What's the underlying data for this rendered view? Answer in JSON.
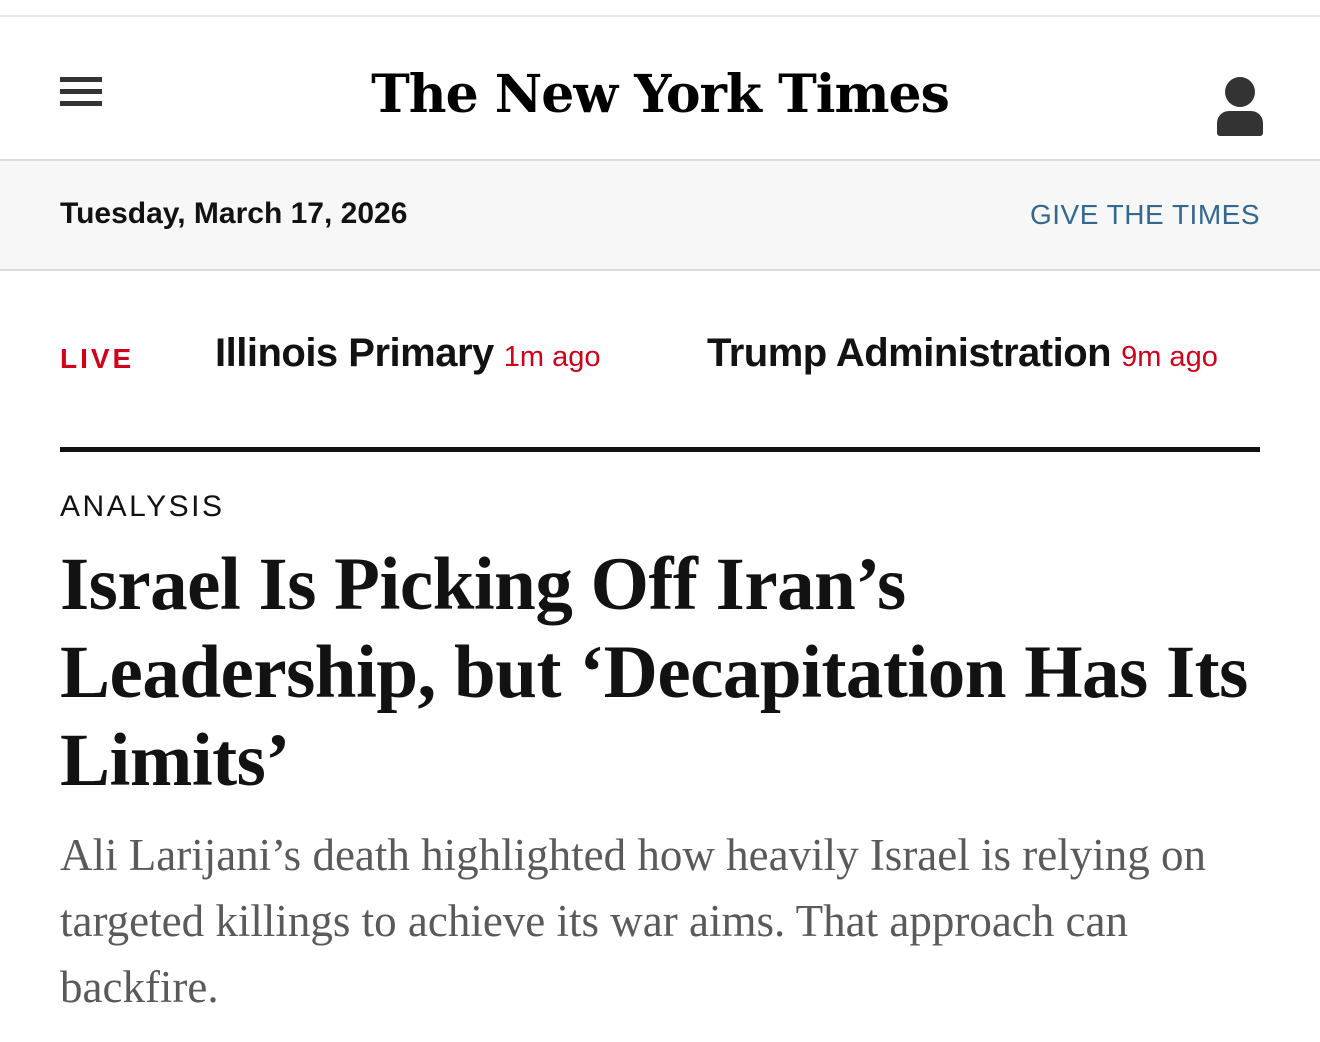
{
  "header": {
    "menu_icon": "hamburger-menu-icon",
    "logo_text": "The New York Times",
    "account_icon": "user-account-icon"
  },
  "date_bar": {
    "date": "Tuesday, March 17, 2026",
    "give_link": "GIVE THE TIMES"
  },
  "live_bar": {
    "label": "LIVE",
    "items": [
      {
        "title": "Illinois Primary",
        "time": "1m ago"
      },
      {
        "title": "Trump Administration",
        "time": "9m ago"
      }
    ]
  },
  "article": {
    "kicker": "ANALYSIS",
    "headline": "Israel Is Picking Off Iran’s Leadership, but ‘Decapitation Has Its Limits’",
    "summary": "Ali Larijani’s death highlighted how heavily Israel is relying on targeted killings to achieve its war aims. That approach can backfire."
  },
  "colors": {
    "live_red": "#d0021b",
    "link_blue": "#326891",
    "text_dark": "#121212",
    "summary_gray": "#5a5a5a",
    "date_bar_bg": "#f7f7f7"
  }
}
